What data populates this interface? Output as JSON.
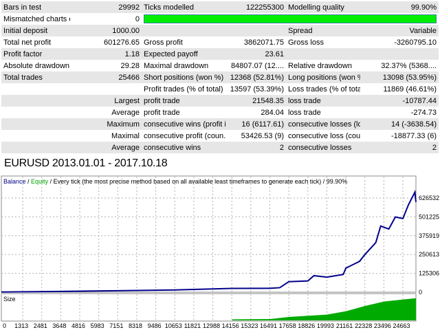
{
  "stats": {
    "r1": [
      "Bars in test",
      "29992",
      "Ticks modelled",
      "122255300",
      "Modelling quality",
      "99.90%"
    ],
    "r2": [
      "Mismatched charts e...",
      "0"
    ],
    "modelling_quality_fraction": 0.999,
    "r3": [
      "Initial deposit",
      "1000.00",
      "",
      "",
      "Spread",
      "Variable"
    ],
    "r4": [
      "Total net profit",
      "601276.65",
      "Gross profit",
      "3862071.75",
      "Gross loss",
      "-3260795.10"
    ],
    "r5": [
      "Profit factor",
      "1.18",
      "Expected payoff",
      "23.61",
      "",
      ""
    ],
    "r6": [
      "Absolute drawdown",
      "29.28",
      "Maximal drawdown",
      "84807.07 (12....",
      "Relative drawdown",
      "32.37% (5368...."
    ],
    "r7": [
      "Total trades",
      "25466",
      "Short positions (won %)",
      "12368 (52.81%)",
      "Long positions (won %)",
      "13098 (53.95%)"
    ],
    "r8": [
      "",
      "",
      "Profit trades (% of total)",
      "13597 (53.39%)",
      "Loss trades (% of total)",
      "11869 (46.61%)"
    ],
    "r9": [
      "",
      "Largest",
      "profit trade",
      "21548.35",
      "loss trade",
      "-10787.44"
    ],
    "r10": [
      "",
      "Average",
      "profit trade",
      "284.04",
      "loss trade",
      "-274.73"
    ],
    "r11": [
      "",
      "Maximum",
      "consecutive wins (profit i...",
      "16 (6117.61)",
      "consecutive losses (loss i...",
      "14 (-3638.54)"
    ],
    "r12": [
      "",
      "Maximal",
      "consecutive profit (coun...",
      "53426.53 (9)",
      "consecutive loss (count ...",
      "-18877.33 (6)"
    ],
    "r13": [
      "",
      "Average",
      "consecutive wins",
      "2",
      "consecutive losses",
      "2"
    ]
  },
  "chart_title": "EURUSD 2013.01.01 - 2017.10.18",
  "chart_data": {
    "type": "line",
    "legend": {
      "balance": "Balance",
      "sep1": " / ",
      "equity": "Equity",
      "rest": " / Every tick (the most precise method based on all available least timeframes to generate each tick) / 99.90%"
    },
    "size_label": "Size",
    "colors": {
      "balance": "#00008b",
      "equity": "#00a000",
      "size": "#00aa00",
      "grid": "#b0b0b0"
    },
    "yticks": [
      0,
      125306,
      250613,
      375919,
      501225,
      626532
    ],
    "xticks": [
      0,
      1313,
      2481,
      3648,
      4816,
      5983,
      7151,
      8318,
      9486,
      10653,
      11821,
      12988,
      14156,
      15323,
      16491,
      17658,
      18826,
      19993,
      21161,
      22328,
      23496,
      24663
    ],
    "xlim": [
      0,
      25466
    ],
    "ylim": [
      0,
      720000
    ],
    "balance": [
      [
        0,
        1000
      ],
      [
        3648,
        5000
      ],
      [
        7151,
        10000
      ],
      [
        10653,
        15000
      ],
      [
        14156,
        25000
      ],
      [
        16491,
        26000
      ],
      [
        17100,
        30000
      ],
      [
        17658,
        70000
      ],
      [
        18826,
        75000
      ],
      [
        19200,
        110000
      ],
      [
        19993,
        100000
      ],
      [
        21000,
        118000
      ],
      [
        21161,
        160000
      ],
      [
        22000,
        205000
      ],
      [
        22328,
        250000
      ],
      [
        23000,
        330000
      ],
      [
        23300,
        440000
      ],
      [
        23800,
        420000
      ],
      [
        24200,
        500000
      ],
      [
        24663,
        490000
      ],
      [
        25000,
        580000
      ],
      [
        25400,
        665000
      ],
      [
        25466,
        600000
      ]
    ],
    "size": [
      [
        0,
        0
      ],
      [
        14156,
        0
      ],
      [
        14200,
        0.04
      ],
      [
        16491,
        0.05
      ],
      [
        17658,
        0.13
      ],
      [
        19993,
        0.22
      ],
      [
        21161,
        0.35
      ],
      [
        22328,
        0.55
      ],
      [
        23496,
        0.72
      ],
      [
        24663,
        0.8
      ],
      [
        25466,
        0.85
      ]
    ]
  }
}
